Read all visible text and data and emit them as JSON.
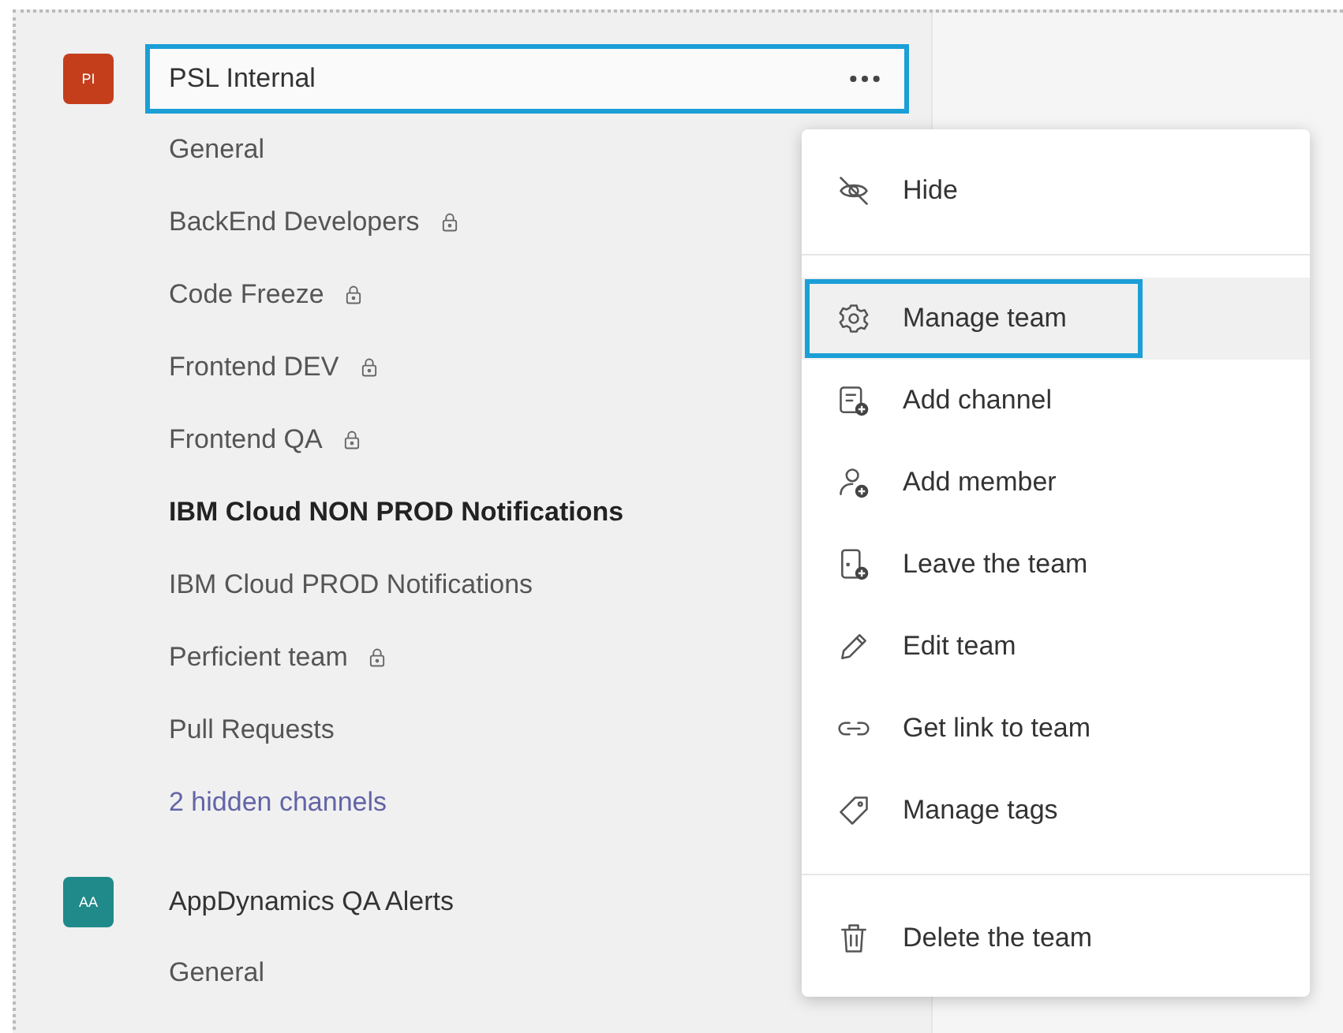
{
  "teams": [
    {
      "initials": "PI",
      "color": "#c43e1c",
      "name": "PSL Internal",
      "selected": true,
      "channels": [
        {
          "name": "General",
          "private": false,
          "unread": false
        },
        {
          "name": "BackEnd Developers",
          "private": true,
          "unread": false
        },
        {
          "name": "Code Freeze",
          "private": true,
          "unread": false
        },
        {
          "name": "Frontend DEV",
          "private": true,
          "unread": false
        },
        {
          "name": "Frontend QA",
          "private": true,
          "unread": false
        },
        {
          "name": "IBM Cloud NON PROD Notifications",
          "private": false,
          "unread": true
        },
        {
          "name": "IBM Cloud PROD Notifications",
          "private": false,
          "unread": false
        },
        {
          "name": "Perficient team",
          "private": true,
          "unread": false
        },
        {
          "name": "Pull Requests",
          "private": false,
          "unread": false
        }
      ],
      "hidden_link": "2 hidden channels"
    },
    {
      "initials": "AA",
      "color": "#1f8a89",
      "name": "AppDynamics QA Alerts",
      "selected": false,
      "channels": [
        {
          "name": "General",
          "private": false,
          "unread": false
        }
      ]
    }
  ],
  "menu": {
    "groups": [
      [
        {
          "label": "Hide",
          "selected": false
        }
      ],
      [
        {
          "label": "Manage team",
          "selected": true
        },
        {
          "label": "Add channel",
          "selected": false
        },
        {
          "label": "Add member",
          "selected": false
        },
        {
          "label": "Leave the team",
          "selected": false
        },
        {
          "label": "Edit team",
          "selected": false
        },
        {
          "label": "Get link to team",
          "selected": false
        },
        {
          "label": "Manage tags",
          "selected": false
        }
      ],
      [
        {
          "label": "Delete the team",
          "selected": false
        }
      ]
    ]
  }
}
